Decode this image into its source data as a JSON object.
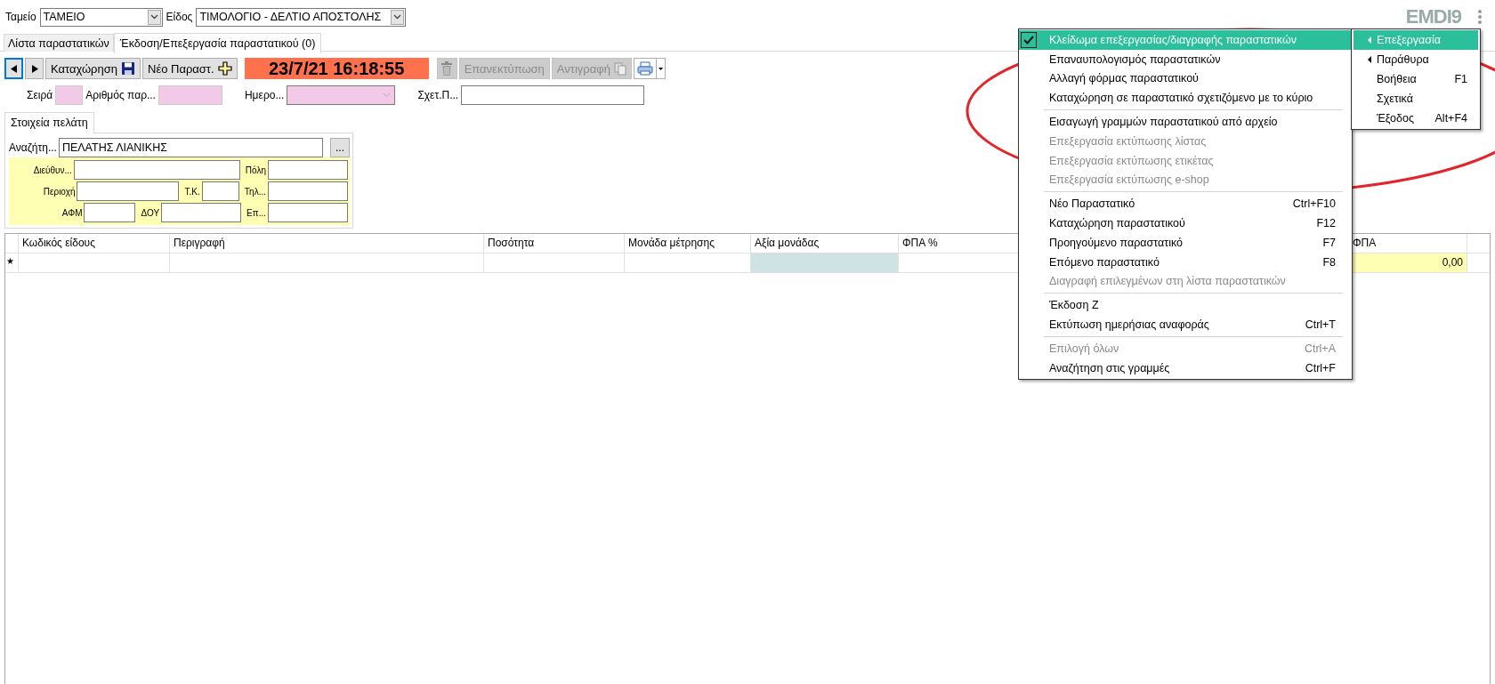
{
  "top_bar": {
    "fields": [
      {
        "label": "Ταμείο",
        "value": "ΤΑΜΕΙΟ"
      },
      {
        "label": "Είδος",
        "value": "ΤΙΜΟΛΟΓΙΟ - ΔΕΛΤΙΟ ΑΠΟΣΤΟΛΗΣ"
      }
    ],
    "logo": {
      "text": "EMDI9"
    }
  },
  "tabs": [
    {
      "label": "Λίστα παραστατικών",
      "selected": false
    },
    {
      "label": "Έκδοση/Επεξεργασία παραστατικού (0)",
      "selected": true
    }
  ],
  "toolbar": {
    "buttons": [
      {
        "kind": "prev",
        "disabled": false
      },
      {
        "kind": "next",
        "disabled": false
      },
      {
        "kind": "save",
        "label": "Καταχώρηση",
        "disabled": false
      },
      {
        "kind": "new",
        "label": "Νέο Παραστ.",
        "disabled": false
      }
    ],
    "clock": "23/7/21 16:18:55",
    "actions": [
      {
        "kind": "trash",
        "disabled": true
      },
      {
        "kind": "text",
        "label": "Επανεκτύπωση",
        "disabled": true
      },
      {
        "kind": "copy",
        "label": "Αντιγραφή",
        "disabled": true
      },
      {
        "kind": "print"
      }
    ]
  },
  "doc_fields": [
    {
      "label": "Σειρά",
      "kind": "pink"
    },
    {
      "label": "Αριθμός παρ...",
      "kind": "pink"
    },
    {
      "label": "Ημερο...",
      "kind": "pinkdrop"
    },
    {
      "label": "Σχετ.Π...",
      "kind": "plain"
    }
  ],
  "customer": {
    "tab": "Στοιχεία πελάτη",
    "search_label": "Αναζήτη...",
    "search_value": "ΠΕΛΑΤΗΣ ΛΙΑΝΙΚΗΣ",
    "browse": "...",
    "fields": [
      "Διεύθυν...",
      "Πόλη",
      "Περιοχή",
      "Τ.Κ.",
      "Τηλ...",
      "ΑΦΜ",
      "ΔΟΥ",
      "Επ..."
    ]
  },
  "table": {
    "columns": [
      "Κωδικός είδους",
      "Περιγραφή",
      "Ποσότητα",
      "Μονάδα μέτρησης",
      "Αξία μονάδας",
      "ΦΠΑ %",
      "ΦΠΑ"
    ],
    "new_row_marker": "★",
    "new_row_total": "0,00"
  },
  "menu": {
    "items": [
      {
        "kind": "item",
        "label": "Κλείδωμα επεξεργασίας/διαγραφής παραστατικών",
        "checked": true,
        "selected": true,
        "disabled": false
      },
      {
        "kind": "item",
        "label": "Επαναυπολογισμός παραστατικών",
        "checked": false,
        "selected": false,
        "disabled": false
      },
      {
        "kind": "item",
        "label": "Αλλαγή φόρμας παραστατικού",
        "checked": false,
        "selected": false,
        "disabled": false
      },
      {
        "kind": "item",
        "label": "Καταχώρηση σε παραστατικό σχετιζόμενο με το κύριο",
        "checked": false,
        "selected": false,
        "disabled": false
      },
      {
        "kind": "separator"
      },
      {
        "kind": "item",
        "label": "Εισαγωγή γραμμών παραστατικού από αρχείο",
        "checked": false,
        "selected": false,
        "disabled": false
      },
      {
        "kind": "item",
        "label": "Επεξεργασία εκτύπωσης λίστας",
        "checked": false,
        "selected": false,
        "disabled": true
      },
      {
        "kind": "item",
        "label": "Επεξεργασία εκτύπωσης ετικέτας",
        "checked": false,
        "selected": false,
        "disabled": true
      },
      {
        "kind": "item",
        "label": "Επεξεργασία εκτύπωσης e-shop",
        "checked": false,
        "selected": false,
        "disabled": true
      },
      {
        "kind": "separator"
      },
      {
        "kind": "item",
        "label": "Νέο Παραστατικό",
        "shortcut": "Ctrl+F10",
        "checked": false,
        "selected": false,
        "disabled": false
      },
      {
        "kind": "item",
        "label": "Καταχώρηση παραστατικού",
        "shortcut": "F12",
        "checked": false,
        "selected": false,
        "disabled": false
      },
      {
        "kind": "item",
        "label": "Προηγούμενο παραστατικό",
        "shortcut": "F7",
        "checked": false,
        "selected": false,
        "disabled": false
      },
      {
        "kind": "item",
        "label": "Επόμενο παραστατικό",
        "shortcut": "F8",
        "checked": false,
        "selected": false,
        "disabled": false
      },
      {
        "kind": "item",
        "label": "Διαγραφή επιλεγμένων στη λίστα παραστατικών",
        "checked": false,
        "selected": false,
        "disabled": true
      },
      {
        "kind": "separator"
      },
      {
        "kind": "item",
        "label": "Έκδοση Ζ",
        "checked": false,
        "selected": false,
        "disabled": false
      },
      {
        "kind": "item",
        "label": "Εκτύπωση ημερήσιας αναφοράς",
        "shortcut": "Ctrl+T",
        "checked": false,
        "selected": false,
        "disabled": false
      },
      {
        "kind": "separator"
      },
      {
        "kind": "item",
        "label": "Επιλογή όλων",
        "shortcut": "Ctrl+A",
        "checked": false,
        "selected": false,
        "disabled": true
      },
      {
        "kind": "item",
        "label": "Αναζήτηση στις γραμμές",
        "shortcut": "Ctrl+F",
        "checked": false,
        "selected": false,
        "disabled": false
      }
    ]
  },
  "main_menu": {
    "items": [
      {
        "label": "Επεξεργασία",
        "submenu": true,
        "selected": true
      },
      {
        "label": "Παράθυρα",
        "submenu": true,
        "selected": false
      },
      {
        "label": "Βοήθεια",
        "shortcut": "F1",
        "submenu": false,
        "selected": false
      },
      {
        "label": "Σχετικά",
        "submenu": false,
        "selected": false
      },
      {
        "label": "Έξοδος",
        "shortcut": "Alt+F4",
        "submenu": false,
        "selected": false
      }
    ]
  }
}
